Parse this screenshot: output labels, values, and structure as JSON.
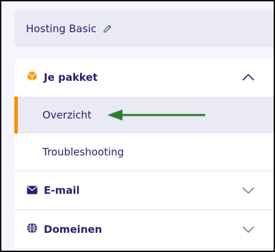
{
  "hosting": {
    "title": "Hosting Basic",
    "edit_icon": "pencil-icon"
  },
  "menu": {
    "sections": [
      {
        "label": "Je pakket",
        "icon": "package-icon",
        "expanded": true,
        "items": [
          {
            "label": "Overzicht",
            "active": true
          },
          {
            "label": "Troubleshooting",
            "active": false
          }
        ]
      },
      {
        "label": "E-mail",
        "icon": "envelope-icon",
        "expanded": false
      },
      {
        "label": "Domeinen",
        "icon": "globe-icon",
        "expanded": false
      }
    ]
  },
  "colors": {
    "text": "#2f1c6a",
    "accent": "#ff8c00",
    "active_bg": "#e9eaf3",
    "annotation_arrow": "#2e7d32"
  }
}
